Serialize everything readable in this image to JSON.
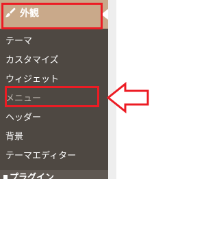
{
  "menu": {
    "header_label": "外観",
    "items": [
      {
        "label": "テーマ"
      },
      {
        "label": "カスタマイズ"
      },
      {
        "label": "ウィジェット"
      },
      {
        "label": "メニュー"
      },
      {
        "label": "ヘッダー"
      },
      {
        "label": "背景"
      },
      {
        "label": "テーマエディター"
      }
    ],
    "next_section_label": "プラグイン"
  },
  "icons": {
    "header": "paint-brush-icon",
    "next_section": "plugin-icon"
  },
  "colors": {
    "menu_background": "#4e4842",
    "header_background": "#c9a98a",
    "highlight": "#ec1c24"
  }
}
